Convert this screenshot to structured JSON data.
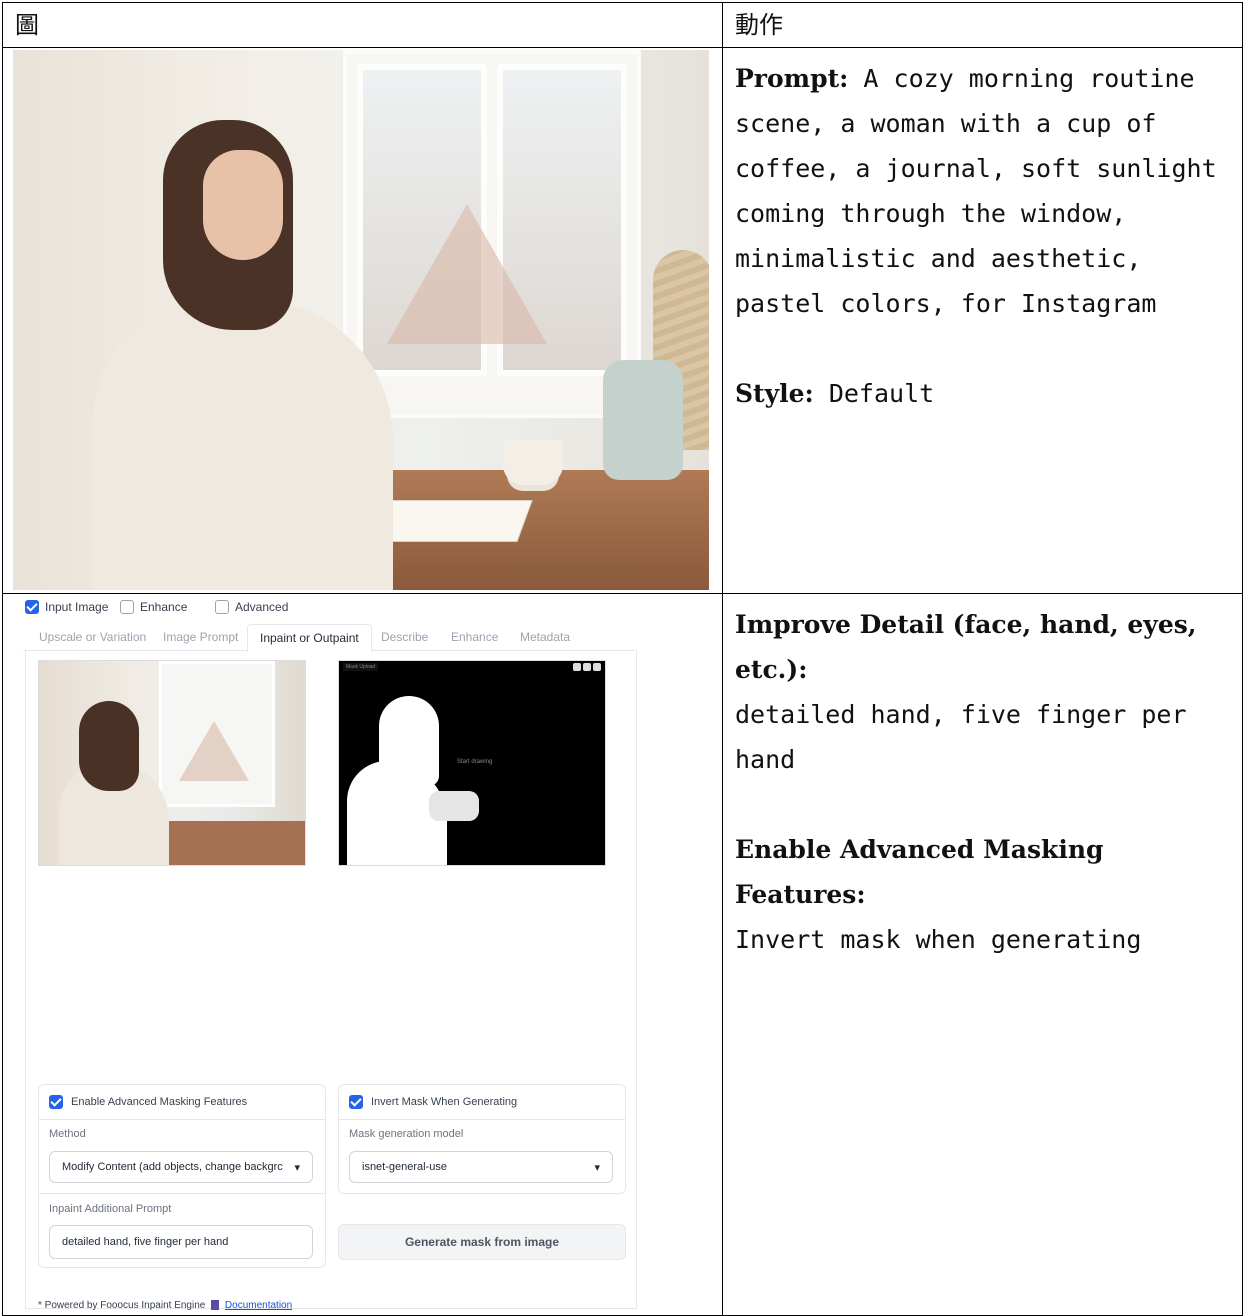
{
  "header": {
    "col_figure": "圖",
    "col_action": "動作"
  },
  "row1": {
    "prompt_label": "Prompt:",
    "prompt_text": "A cozy morning routine scene, a woman with a cup of coffee, a journal, soft sunlight coming through the window, minimalistic and aesthetic, pastel colors, for Instagram",
    "style_label": "Style:",
    "style_value": "Default"
  },
  "row2": {
    "improve_label": "Improve Detail (face, hand, eyes, etc.):",
    "improve_text": "detailed hand, five finger per hand",
    "masking_label": "Enable Advanced Masking Features:",
    "masking_text": "Invert mask when generating"
  },
  "ui": {
    "checkboxes": [
      {
        "label": "Input Image",
        "checked": true
      },
      {
        "label": "Enhance",
        "checked": false
      },
      {
        "label": "Advanced",
        "checked": false
      }
    ],
    "tabs": [
      "Upscale or Variation",
      "Image Prompt",
      "Inpaint or Outpaint",
      "Describe",
      "Enhance",
      "Metadata"
    ],
    "active_tab": "Inpaint or Outpaint",
    "mask_upload_tag": "Mask Upload",
    "start_drawing": "Start drawing",
    "enable_masking_label": "Enable Advanced Masking Features",
    "invert_mask_label": "Invert Mask When Generating",
    "method_label": "Method",
    "method_value": "Modify Content (add objects, change backgrc",
    "mask_model_label": "Mask generation model",
    "mask_model_value": "isnet-general-use",
    "inpaint_prompt_label": "Inpaint Additional Prompt",
    "inpaint_prompt_value": "detailed hand, five finger per hand",
    "generate_button": "Generate mask from image",
    "footer_text": "* Powered by Fooocus Inpaint Engine",
    "footer_link": "Documentation"
  }
}
